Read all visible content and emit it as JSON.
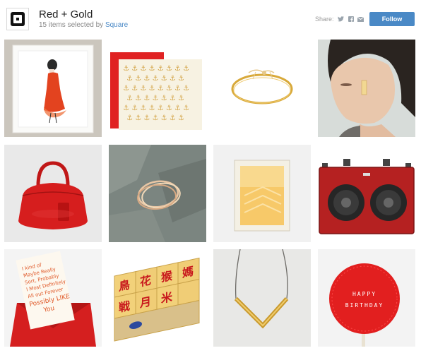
{
  "header": {
    "title": "Red + Gold",
    "subtitle_prefix": "15 items selected by ",
    "curator": "Square",
    "share_label": "Share:",
    "follow_label": "Follow"
  },
  "icons": [
    "square-logo-icon",
    "twitter-icon",
    "facebook-icon",
    "email-icon"
  ],
  "items": [
    {
      "name": "red-dress-illustration-print"
    },
    {
      "name": "gold-anchor-greeting-card"
    },
    {
      "name": "gold-bar-bracelet"
    },
    {
      "name": "gold-earring-portrait"
    },
    {
      "name": "red-leather-handbag"
    },
    {
      "name": "stacked-gold-rings"
    },
    {
      "name": "gold-chevron-print"
    },
    {
      "name": "red-vintage-boombox"
    },
    {
      "name": "love-letter-card",
      "text": [
        "I kind of",
        "Maybe Really",
        "Sort, Probably",
        "I Most Definitely",
        "All out Forever",
        "Possibly LIKE",
        "You"
      ]
    },
    {
      "name": "chinese-character-blocks",
      "text": [
        "鳥",
        "花",
        "猴",
        "媽",
        "戦",
        "月",
        "米"
      ]
    },
    {
      "name": "gold-chevron-necklace"
    },
    {
      "name": "happy-birthday-lollipop",
      "text": [
        "HAPPY",
        "BIRTHDAY"
      ]
    }
  ],
  "colors": {
    "follow": "#4a89c6",
    "link": "#4a89c6",
    "accent_red": "#d42a2a",
    "gold": "#d4a64a"
  }
}
